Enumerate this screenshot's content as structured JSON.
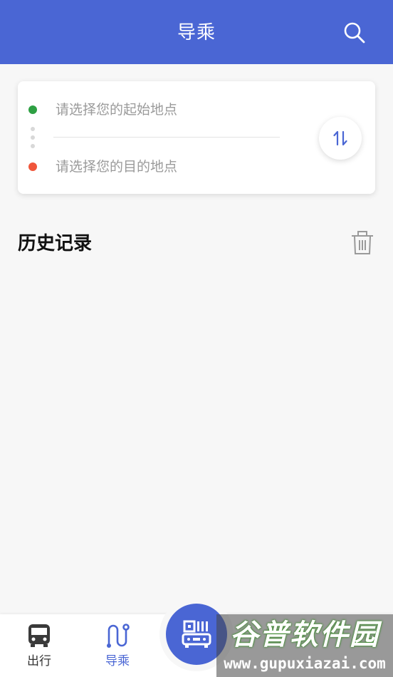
{
  "header": {
    "title": "导乘"
  },
  "route": {
    "start_placeholder": "请选择您的起始地点",
    "end_placeholder": "请选择您的目的地点"
  },
  "history": {
    "title": "历史记录"
  },
  "tabs": [
    {
      "label": "出行",
      "icon": "bus-icon",
      "active": false
    },
    {
      "label": "导乘",
      "icon": "route-icon",
      "active": true
    }
  ],
  "center_button": {
    "icon": "qr-bus-icon"
  },
  "watermark": {
    "title": "谷普软件园",
    "url": "www.gupuxiazai.com"
  },
  "colors": {
    "primary": "#4a66d4",
    "start_dot": "#2ea043",
    "end_dot": "#f0563b"
  }
}
